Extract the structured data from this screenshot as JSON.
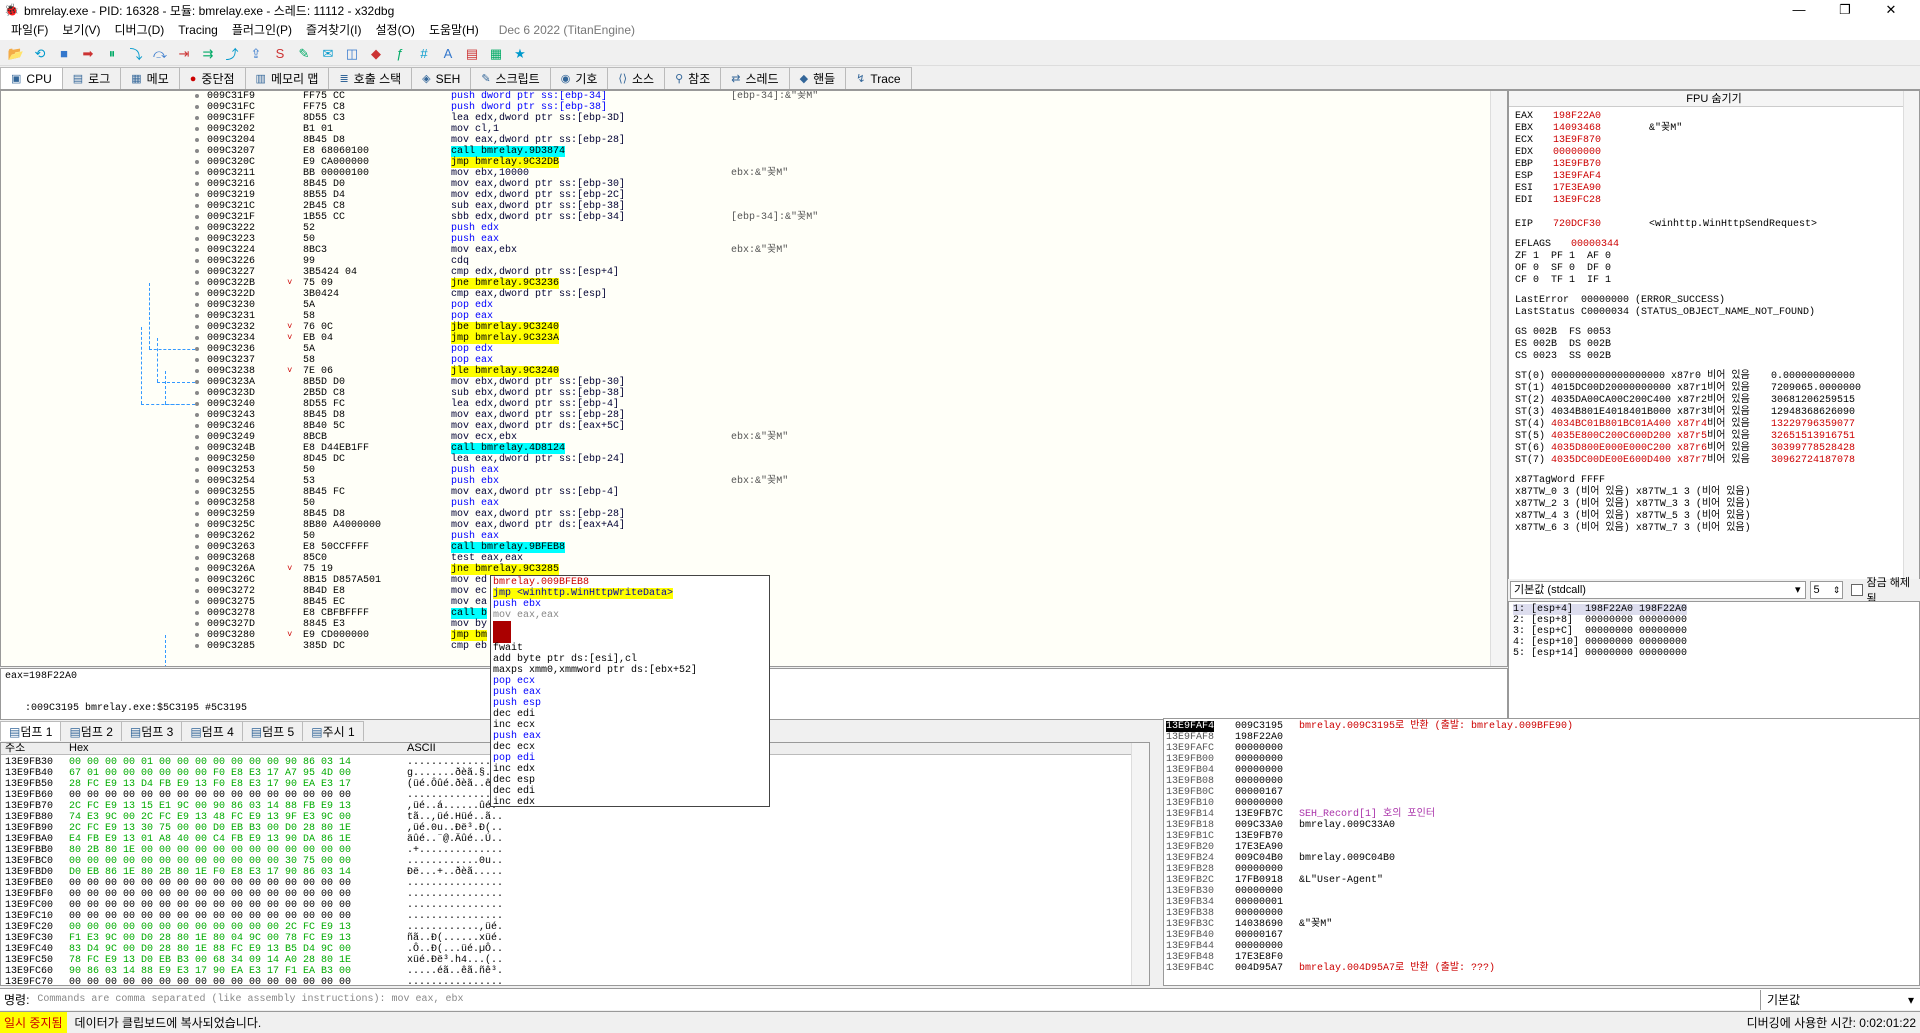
{
  "window": {
    "title": "bmrelay.exe - PID: 16328 - 모듈: bmrelay.exe - 스레드: 11112 - x32dbg",
    "min": "—",
    "max": "❐",
    "close": "✕"
  },
  "menu": {
    "items": [
      "파일(F)",
      "보기(V)",
      "디버그(D)",
      "Tracing",
      "플러그인(P)",
      "즐겨찾기(I)",
      "설정(O)",
      "도움말(H)"
    ],
    "build": "Dec 6 2022 (TitanEngine)"
  },
  "tabs": [
    {
      "label": "CPU",
      "icon": "cpu-icon"
    },
    {
      "label": "로그",
      "icon": "log-icon"
    },
    {
      "label": "메모",
      "icon": "notes-icon"
    },
    {
      "label": "중단점",
      "icon": "breakpoint-icon"
    },
    {
      "label": "메모리 맵",
      "icon": "memory-icon"
    },
    {
      "label": "호출 스택",
      "icon": "callstack-icon"
    },
    {
      "label": "SEH",
      "icon": "seh-icon"
    },
    {
      "label": "스크립트",
      "icon": "script-icon"
    },
    {
      "label": "기호",
      "icon": "symbol-icon"
    },
    {
      "label": "소스",
      "icon": "source-icon"
    },
    {
      "label": "참조",
      "icon": "reference-icon"
    },
    {
      "label": "스레드",
      "icon": "thread-icon"
    },
    {
      "label": "핸들",
      "icon": "handle-icon"
    },
    {
      "label": "Trace",
      "icon": "trace-icon"
    }
  ],
  "disasm": [
    {
      "a": "009C31F9",
      "b": "FF75 CC",
      "i": "push dword ptr ss:[ebp-34]",
      "c": "[ebp-34]:&\"꽂M\""
    },
    {
      "a": "009C31FC",
      "b": "FF75 C8",
      "i": "push dword ptr ss:[ebp-38]",
      "c": ""
    },
    {
      "a": "009C31FF",
      "b": "8D55 C3",
      "i": "lea edx,dword ptr ss:[ebp-3D]",
      "c": ""
    },
    {
      "a": "009C3202",
      "b": "B1 01",
      "i": "mov cl,1",
      "c": ""
    },
    {
      "a": "009C3204",
      "b": "8B45 D8",
      "i": "mov eax,dword ptr ss:[ebp-28]",
      "c": ""
    },
    {
      "a": "009C3207",
      "b": "E8 68060100",
      "i": "call bmrelay.9D3874",
      "c": "",
      "t": "call"
    },
    {
      "a": "009C320C",
      "b": "E9 CA000000",
      "i": "jmp bmrelay.9C32DB",
      "c": "",
      "t": "jmp"
    },
    {
      "a": "009C3211",
      "b": "BB 00000100",
      "i": "mov ebx,10000",
      "c": "ebx:&\"꽂M\""
    },
    {
      "a": "009C3216",
      "b": "8B45 D0",
      "i": "mov eax,dword ptr ss:[ebp-30]",
      "c": ""
    },
    {
      "a": "009C3219",
      "b": "8B55 D4",
      "i": "mov edx,dword ptr ss:[ebp-2C]",
      "c": ""
    },
    {
      "a": "009C321C",
      "b": "2B45 C8",
      "i": "sub eax,dword ptr ss:[ebp-38]",
      "c": ""
    },
    {
      "a": "009C321F",
      "b": "1B55 CC",
      "i": "sbb edx,dword ptr ss:[ebp-34]",
      "c": "[ebp-34]:&\"꽂M\""
    },
    {
      "a": "009C3222",
      "b": "52",
      "i": "push edx",
      "c": ""
    },
    {
      "a": "009C3223",
      "b": "50",
      "i": "push eax",
      "c": ""
    },
    {
      "a": "009C3224",
      "b": "8BC3",
      "i": "mov eax,ebx",
      "c": "ebx:&\"꽂M\""
    },
    {
      "a": "009C3226",
      "b": "99",
      "i": "cdq",
      "c": ""
    },
    {
      "a": "009C3227",
      "b": "3B5424 04",
      "i": "cmp edx,dword ptr ss:[esp+4]",
      "c": ""
    },
    {
      "a": "009C322B",
      "b": "75 09",
      "i": "jne bmrelay.9C3236",
      "c": "",
      "t": "jmp",
      "arr": "v"
    },
    {
      "a": "009C322D",
      "b": "3B0424",
      "i": "cmp eax,dword ptr ss:[esp]",
      "c": ""
    },
    {
      "a": "009C3230",
      "b": "5A",
      "i": "pop edx",
      "c": ""
    },
    {
      "a": "009C3231",
      "b": "58",
      "i": "pop eax",
      "c": ""
    },
    {
      "a": "009C3232",
      "b": "76 0C",
      "i": "jbe bmrelay.9C3240",
      "c": "",
      "t": "jmp",
      "arr": "v"
    },
    {
      "a": "009C3234",
      "b": "EB 04",
      "i": "jmp bmrelay.9C323A",
      "c": "",
      "t": "jmp",
      "arr": "v"
    },
    {
      "a": "009C3236",
      "b": "5A",
      "i": "pop edx",
      "c": ""
    },
    {
      "a": "009C3237",
      "b": "58",
      "i": "pop eax",
      "c": ""
    },
    {
      "a": "009C3238",
      "b": "7E 06",
      "i": "jle bmrelay.9C3240",
      "c": "",
      "t": "jmp",
      "arr": "v"
    },
    {
      "a": "009C323A",
      "b": "8B5D D0",
      "i": "mov ebx,dword ptr ss:[ebp-30]",
      "c": ""
    },
    {
      "a": "009C323D",
      "b": "2B5D C8",
      "i": "sub ebx,dword ptr ss:[ebp-38]",
      "c": ""
    },
    {
      "a": "009C3240",
      "b": "8D55 FC",
      "i": "lea edx,dword ptr ss:[ebp-4]",
      "c": ""
    },
    {
      "a": "009C3243",
      "b": "8B45 D8",
      "i": "mov eax,dword ptr ss:[ebp-28]",
      "c": ""
    },
    {
      "a": "009C3246",
      "b": "8B40 5C",
      "i": "mov eax,dword ptr ds:[eax+5C]",
      "c": ""
    },
    {
      "a": "009C3249",
      "b": "8BCB",
      "i": "mov ecx,ebx",
      "c": "ebx:&\"꽂M\""
    },
    {
      "a": "009C324B",
      "b": "E8 D44EB1FF",
      "i": "call bmrelay.4D8124",
      "c": "",
      "t": "call"
    },
    {
      "a": "009C3250",
      "b": "8D45 DC",
      "i": "lea eax,dword ptr ss:[ebp-24]",
      "c": ""
    },
    {
      "a": "009C3253",
      "b": "50",
      "i": "push eax",
      "c": ""
    },
    {
      "a": "009C3254",
      "b": "53",
      "i": "push ebx",
      "c": "ebx:&\"꽂M\""
    },
    {
      "a": "009C3255",
      "b": "8B45 FC",
      "i": "mov eax,dword ptr ss:[ebp-4]",
      "c": ""
    },
    {
      "a": "009C3258",
      "b": "50",
      "i": "push eax",
      "c": ""
    },
    {
      "a": "009C3259",
      "b": "8B45 D8",
      "i": "mov eax,dword ptr ss:[ebp-28]",
      "c": ""
    },
    {
      "a": "009C325C",
      "b": "8B80 A4000000",
      "i": "mov eax,dword ptr ds:[eax+A4]",
      "c": ""
    },
    {
      "a": "009C3262",
      "b": "50",
      "i": "push eax",
      "c": ""
    },
    {
      "a": "009C3263",
      "b": "E8 50CCFFFF",
      "i": "call bmrelay.9BFEB8",
      "c": "",
      "t": "call"
    },
    {
      "a": "009C3268",
      "b": "85C0",
      "i": "test eax,eax",
      "c": ""
    },
    {
      "a": "009C326A",
      "b": "75 19",
      "i": "jne bmrelay.9C3285",
      "c": "",
      "t": "jmp",
      "arr": "v"
    },
    {
      "a": "009C326C",
      "b": "8B15 D857A501",
      "i": "mov ed",
      "c": ""
    },
    {
      "a": "009C3272",
      "b": "8B4D E8",
      "i": "mov ec",
      "c": ""
    },
    {
      "a": "009C3275",
      "b": "8B45 EC",
      "i": "mov ea",
      "c": ""
    },
    {
      "a": "009C3278",
      "b": "E8 CBFBFFFF",
      "i": "call b",
      "c": "",
      "t": "call"
    },
    {
      "a": "009C327D",
      "b": "8845 E3",
      "i": "mov by",
      "c": ""
    },
    {
      "a": "009C3280",
      "b": "E9 CD000000",
      "i": "jmp bm",
      "c": "",
      "t": "jmp",
      "arr": "v"
    },
    {
      "a": "009C3285",
      "b": "385D DC",
      "i": "cmp eb",
      "c": ""
    }
  ],
  "info": {
    "line1": "eax=198F22A0",
    "line2": ":009C3195 bmrelay.exe:$5C3195 #5C3195"
  },
  "popup": [
    {
      "t": "bmrelay.009BFEB8",
      "c": "red"
    },
    {
      "t": "jmp <winhttp.WinHttpWriteData>",
      "c": "jmp"
    },
    {
      "t": "push ebx",
      "c": "blue"
    },
    {
      "t": "mov eax,eax",
      "c": "gray"
    },
    {
      "t": "???",
      "c": "redbox"
    },
    {
      "t": "???",
      "c": "redbox"
    },
    {
      "t": "fwait",
      "c": ""
    },
    {
      "t": "add byte ptr ds:[esi],cl",
      "c": ""
    },
    {
      "t": "maxps xmm0,xmmword ptr ds:[ebx+52]",
      "c": ""
    },
    {
      "t": "pop ecx",
      "c": "blue"
    },
    {
      "t": "push eax",
      "c": "blue"
    },
    {
      "t": "push esp",
      "c": "blue"
    },
    {
      "t": "dec edi",
      "c": ""
    },
    {
      "t": "inc ecx",
      "c": ""
    },
    {
      "t": "push eax",
      "c": "blue"
    },
    {
      "t": "dec ecx",
      "c": ""
    },
    {
      "t": "pop edi",
      "c": "blue"
    },
    {
      "t": "inc edx",
      "c": ""
    },
    {
      "t": "dec esp",
      "c": ""
    },
    {
      "t": "dec edi",
      "c": ""
    },
    {
      "t": "inc edx",
      "c": ""
    }
  ],
  "fpu_header": "FPU 숨기기",
  "regs": [
    {
      "n": "EAX",
      "v": "198F22A0",
      "c": ""
    },
    {
      "n": "EBX",
      "v": "14093468",
      "c": "&\"꽂M\""
    },
    {
      "n": "ECX",
      "v": "13E9F870",
      "c": ""
    },
    {
      "n": "EDX",
      "v": "00000000",
      "c": ""
    },
    {
      "n": "EBP",
      "v": "13E9FB70",
      "c": ""
    },
    {
      "n": "ESP",
      "v": "13E9FAF4",
      "c": ""
    },
    {
      "n": "ESI",
      "v": "17E3EA90",
      "c": ""
    },
    {
      "n": "EDI",
      "v": "13E9FC28",
      "c": ""
    }
  ],
  "eip": {
    "n": "EIP",
    "v": "720DCF30",
    "c": "<winhttp.WinHttpSendRequest>"
  },
  "eflags": {
    "n": "EFLAGS",
    "v": "00000344"
  },
  "flags": [
    "ZF 1  PF 1  AF 0",
    "OF 0  SF 0  DF 0",
    "CF 0  TF 1  IF 1"
  ],
  "lasterror": "LastError  00000000 (ERROR_SUCCESS)",
  "laststatus": "LastStatus C0000034 (STATUS_OBJECT_NAME_NOT_FOUND)",
  "segs": [
    "GS 002B  FS 0053",
    "ES 002B  DS 002B",
    "CS 0023  SS 002B"
  ],
  "st": [
    {
      "n": "ST(0)",
      "v": "0000000000000000000 x87r0",
      "e": "비어 있음",
      "f": "0.000000000000"
    },
    {
      "n": "ST(1)",
      "v": "4015DC00D20000000000 x87r1",
      "e": "비어 있음",
      "f": "7209065.0000000"
    },
    {
      "n": "ST(2)",
      "v": "4035DA00CA00C200C400 x87r2",
      "e": "비어 있음",
      "f": "30681206259515"
    },
    {
      "n": "ST(3)",
      "v": "4034B801E4018401B000 x87r3",
      "e": "비어 있음",
      "f": "12948368626090"
    },
    {
      "n": "ST(4)",
      "v": "4034BC01B801BC01A400 x87r4",
      "e": "비어 있음",
      "f": "13229796359077"
    },
    {
      "n": "ST(5)",
      "v": "4035E800C200C600D200 x87r5",
      "e": "비어 있음",
      "f": "32651513916751"
    },
    {
      "n": "ST(6)",
      "v": "4035D800E000E000C200 x87r6",
      "e": "비어 있음",
      "f": "30399778528428"
    },
    {
      "n": "ST(7)",
      "v": "4035DC00DE00E600D400 x87r7",
      "e": "비어 있음",
      "f": "30962724187078"
    }
  ],
  "tagword": "x87TagWord FFFF",
  "tw": [
    "x87TW_0 3 (비어 있음) x87TW_1 3 (비어 있음)",
    "x87TW_2 3 (비어 있음) x87TW_3 3 (비어 있음)",
    "x87TW_4 3 (비어 있음) x87TW_5 3 (비어 있음)",
    "x87TW_6 3 (비어 있음) x87TW_7 3 (비어 있음)"
  ],
  "callconv": {
    "select": "기본값 (stdcall)",
    "count": "5",
    "unlock": "잠금 해제됨"
  },
  "callargs": [
    "1: [esp+4]  198F22A0 198F22A0",
    "2: [esp+8]  00000000 00000000",
    "3: [esp+C]  00000000 00000000",
    "4: [esp+10] 00000000 00000000",
    "5: [esp+14] 00000000 00000000"
  ],
  "dumptabs": [
    "덤프 1",
    "덤프 2",
    "덤프 3",
    "덤프 4",
    "덤프 5",
    "주시 1"
  ],
  "dumphdr": {
    "addr": "주소",
    "hex": "Hex",
    "ascii": "ASCII"
  },
  "dump": [
    {
      "a": "13E9FB30",
      "h": "00 00 00 00 01 00 00 00 00 00 00 00 90 86 03 14",
      "s": "................"
    },
    {
      "a": "13E9FB40",
      "h": "67 01 00 00 00 00 00 00 F0 E8 E3 17 A7 95 4D 00",
      "s": "g.......ðèã.§.M."
    },
    {
      "a": "13E9FB50",
      "h": "28 FC E9 13 D4 FB E9 13 F0 E8 E3 17 90 EA E3 17",
      "s": "(üé.Ôûé.ðèã..êã."
    },
    {
      "a": "13E9FB60",
      "h": "00 00 00 00 00 00 00 00 00 00 00 00 00 00 00 00",
      "s": "................"
    },
    {
      "a": "13E9FB70",
      "h": "2C FC E9 13 15 E1 9C 00 90 86 03 14 88 FB E9 13",
      "s": ",üé..á......ûé."
    },
    {
      "a": "13E9FB80",
      "h": "74 E3 9C 00 2C FC E9 13 48 FC E9 13 9F E3 9C 00",
      "s": "tã..,üé.Hüé..ã.."
    },
    {
      "a": "13E9FB90",
      "h": "2C FC E9 13 30 75 00 00 D0 EB B3 00 D0 28 80 1E",
      "s": ",üé.0u..Ðë³.Ð(.."
    },
    {
      "a": "13E9FBA0",
      "h": "E4 FB E9 13 01 A8 40 00 C4 FB E9 13 90 DA 86 1E",
      "s": "äûé..¨@.Äûé..Ú.."
    },
    {
      "a": "13E9FBB0",
      "h": "80 2B 80 1E 00 00 00 00 00 00 00 00 00 00 00 00",
      "s": ".+.............."
    },
    {
      "a": "13E9FBC0",
      "h": "00 00 00 00 00 00 00 00 00 00 00 00 30 75 00 00",
      "s": "............0u.."
    },
    {
      "a": "13E9FBD0",
      "h": "D0 EB 86 1E 80 2B 80 1E F0 E8 E3 17 90 86 03 14",
      "s": "Ðë...+..ðèã....."
    },
    {
      "a": "13E9FBE0",
      "h": "00 00 00 00 00 00 00 00 00 00 00 00 00 00 00 00",
      "s": "................"
    },
    {
      "a": "13E9FBF0",
      "h": "00 00 00 00 00 00 00 00 00 00 00 00 00 00 00 00",
      "s": "................"
    },
    {
      "a": "13E9FC00",
      "h": "00 00 00 00 00 00 00 00 00 00 00 00 00 00 00 00",
      "s": "................"
    },
    {
      "a": "13E9FC10",
      "h": "00 00 00 00 00 00 00 00 00 00 00 00 00 00 00 00",
      "s": "................"
    },
    {
      "a": "13E9FC20",
      "h": "00 00 00 00 00 00 00 00 00 00 00 00 2C FC E9 13",
      "s": "............,üé."
    },
    {
      "a": "13E9FC30",
      "h": "F1 E3 9C 00 D0 28 80 1E 80 04 9C 00 78 FC E9 13",
      "s": "ñã..Ð(......xüé."
    },
    {
      "a": "13E9FC40",
      "h": "83 D4 9C 00 D0 28 80 1E 88 FC E9 13 B5 D4 9C 00",
      "s": ".Ô..Ð(...üé.µÔ.."
    },
    {
      "a": "13E9FC50",
      "h": "78 FC E9 13 D0 EB B3 00 68 34 09 14 A0 28 80 1E",
      "s": "xüé.Ðë³.h4...(.."
    },
    {
      "a": "13E9FC60",
      "h": "90 86 03 14 88 E9 E3 17 90 EA E3 17 F1 EA B3 00",
      "s": ".....éã..êã.ñê³."
    },
    {
      "a": "13E9FC70",
      "h": "00 00 00 00 00 00 00 00 00 00 00 00 00 00 00 00",
      "s": "................"
    }
  ],
  "stack": [
    {
      "a": "13E9FAF4",
      "v": "009C3195",
      "c": "bmrelay.009C3195로 반환 (출발: bmrelay.009BFE90)",
      "cls": "red",
      "cur": true
    },
    {
      "a": "13E9FAF8",
      "v": "198F22A0",
      "c": ""
    },
    {
      "a": "13E9FAFC",
      "v": "00000000",
      "c": ""
    },
    {
      "a": "13E9FB00",
      "v": "00000000",
      "c": ""
    },
    {
      "a": "13E9FB04",
      "v": "00000000",
      "c": ""
    },
    {
      "a": "13E9FB08",
      "v": "00000000",
      "c": ""
    },
    {
      "a": "13E9FB0C",
      "v": "00000167",
      "c": ""
    },
    {
      "a": "13E9FB10",
      "v": "00000000",
      "c": ""
    },
    {
      "a": "13E9FB14",
      "v": "13E9FB7C",
      "c": "SEH_Record[1] 호의 포인터",
      "cls": "purple"
    },
    {
      "a": "13E9FB18",
      "v": "009C33A0",
      "c": "bmrelay.009C33A0"
    },
    {
      "a": "13E9FB1C",
      "v": "13E9FB70",
      "c": ""
    },
    {
      "a": "13E9FB20",
      "v": "17E3EA90",
      "c": ""
    },
    {
      "a": "13E9FB24",
      "v": "009C04B0",
      "c": "bmrelay.009C04B0"
    },
    {
      "a": "13E9FB28",
      "v": "00000000",
      "c": ""
    },
    {
      "a": "13E9FB2C",
      "v": "17FB0918",
      "c": "&L\"User-Agent\""
    },
    {
      "a": "13E9FB30",
      "v": "00000000",
      "c": ""
    },
    {
      "a": "13E9FB34",
      "v": "00000001",
      "c": ""
    },
    {
      "a": "13E9FB38",
      "v": "00000000",
      "c": ""
    },
    {
      "a": "13E9FB3C",
      "v": "14038690",
      "c": "&\"꽂M\""
    },
    {
      "a": "13E9FB40",
      "v": "00000167",
      "c": ""
    },
    {
      "a": "13E9FB44",
      "v": "00000000",
      "c": ""
    },
    {
      "a": "13E9FB48",
      "v": "17E3E8F0",
      "c": ""
    },
    {
      "a": "13E9FB4C",
      "v": "004D95A7",
      "c": "bmrelay.004D95A7로 반환 (출발: ???)",
      "cls": "red"
    }
  ],
  "cmd": {
    "label": "명령:",
    "placeholder": "Commands are comma separated (like assembly instructions): mov eax, ebx",
    "default": "기본값"
  },
  "status": {
    "state": "일시 중지됨",
    "message": "데이터가 클립보드에 복사되었습니다.",
    "time": "디버깅에 사용한 시간: 0:02:01:22"
  },
  "toolbar": [
    "open-icon",
    "restart-icon",
    "stop-icon",
    "run-icon",
    "pause-icon",
    "step-into-icon",
    "step-over-icon",
    "trace-into-icon",
    "trace-over-icon",
    "execute-till-return-icon",
    "run-to-user-code-icon",
    "scylla-icon",
    "patch-icon",
    "comment-icon",
    "label-icon",
    "bookmark-icon",
    "function-icon",
    "hash-icon",
    "font-icon",
    "graph-icon",
    "calculator-icon",
    "favorite-icon"
  ]
}
